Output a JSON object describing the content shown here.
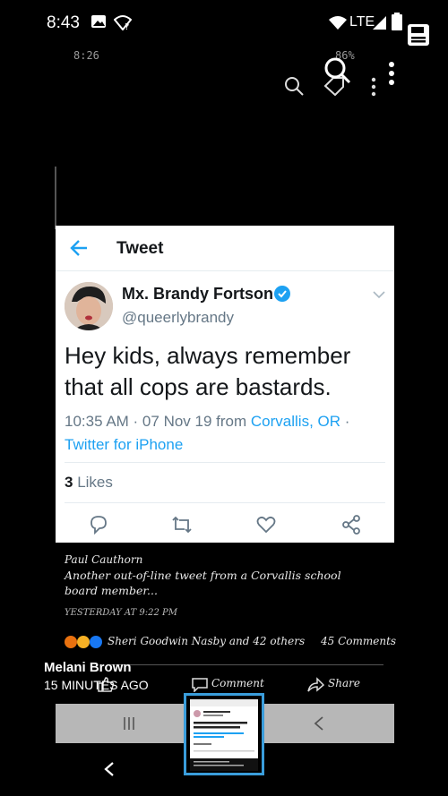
{
  "status_bar": {
    "time": "8:43",
    "network": "LTE"
  },
  "inner_status": {
    "time": "8:26",
    "battery": "86%"
  },
  "tweet": {
    "header_title": "Tweet",
    "author_name": "Mx. Brandy Fortson",
    "handle": "@queerlybrandy",
    "text": "Hey kids, always remember that all cops are bastards.",
    "meta_time": "10:35 AM · 07 Nov 19 from ",
    "meta_location": "Corvallis, OR",
    "meta_sep": " · ",
    "meta_source": "Twitter for iPhone",
    "likes_count": "3",
    "likes_label": "Likes"
  },
  "post": {
    "poster": "Paul Cauthorn",
    "text": "Another out-of-line tweet from a Corvallis school board member...",
    "time": "YESTERDAY AT 9:22 PM",
    "reactions": "Sheri Goodwin Nasby and 42 others",
    "comments": "45 Comments",
    "comment_label": "Comment",
    "share_label": "Share"
  },
  "overlay_comment": {
    "name": "Melani Brown",
    "time": "15 MINUTES AGO"
  },
  "colors": {
    "twitter_blue": "#1da1f2",
    "thumb_border": "#3a9ddb"
  }
}
